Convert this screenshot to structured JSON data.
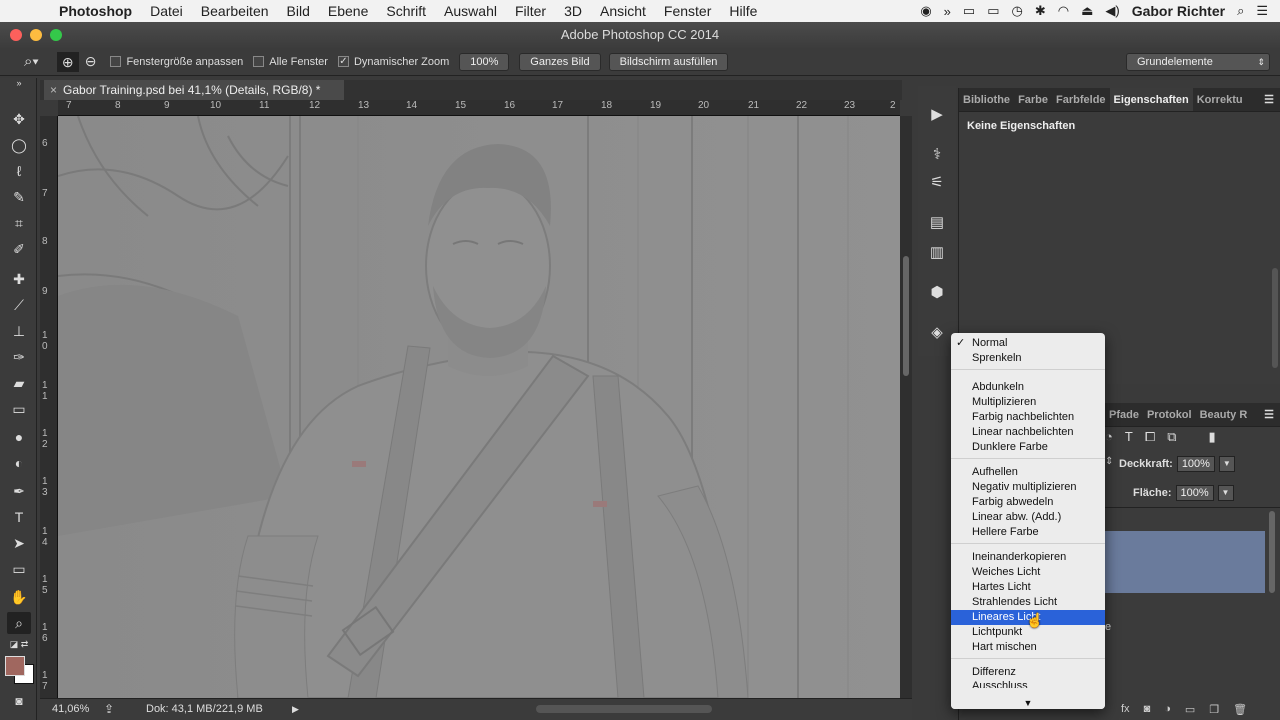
{
  "menubar": {
    "app": "Photoshop",
    "items": [
      "Datei",
      "Bearbeiten",
      "Bild",
      "Ebene",
      "Schrift",
      "Auswahl",
      "Filter",
      "3D",
      "Ansicht",
      "Fenster",
      "Hilfe"
    ],
    "user": "Gabor Richter"
  },
  "window": {
    "title": "Adobe Photoshop CC 2014"
  },
  "options": {
    "fit_window": "Fenstergröße anpassen",
    "all_windows": "Alle Fenster",
    "dynamic_zoom": "Dynamischer Zoom",
    "zoom_100": "100%",
    "fit_screen": "Ganzes Bild",
    "fill_screen": "Bildschirm ausfüllen",
    "workspace": "Grundelemente"
  },
  "document": {
    "tab_title": "Gabor Training.psd bei 41,1% (Details, RGB/8) *",
    "ruler_h": [
      "7",
      "8",
      "9",
      "10",
      "11",
      "12",
      "13",
      "14",
      "15",
      "16",
      "17",
      "18",
      "19",
      "20",
      "21",
      "22",
      "23",
      "2"
    ],
    "ruler_v": [
      "6",
      "7",
      "8",
      "9",
      "1 0",
      "1 1",
      "1 2",
      "1 3",
      "1 4",
      "1 5",
      "1 6",
      "1 7"
    ]
  },
  "status": {
    "zoom": "41,06%",
    "doc_size": "Dok: 43,1 MB/221,9 MB"
  },
  "properties_panel": {
    "tabs": [
      "Bibliothe",
      "Farbe",
      "Farbfelde",
      "Eigenschaften",
      "Korrektu"
    ],
    "active_tab": "Eigenschaften",
    "empty_text": "Keine Eigenschaften"
  },
  "layers_panel": {
    "tabs": [
      "Pfade",
      "Protokol",
      "Beauty R"
    ],
    "opacity_label": "Deckkraft:",
    "opacity_value": "100%",
    "fill_label": "Fläche:",
    "fill_value": "100%",
    "partial_text": "e"
  },
  "blend_menu": {
    "checked": "Normal",
    "selected": "Lineares Licht",
    "groups": [
      [
        "Normal",
        "Sprenkeln"
      ],
      [
        "Abdunkeln",
        "Multiplizieren",
        "Farbig nachbelichten",
        "Linear nachbelichten",
        "Dunklere Farbe"
      ],
      [
        "Aufhellen",
        "Negativ multiplizieren",
        "Farbig abwedeln",
        "Linear abw. (Add.)",
        "Hellere Farbe"
      ],
      [
        "Ineinanderkopieren",
        "Weiches Licht",
        "Hartes Licht",
        "Strahlendes Licht",
        "Lineares Licht",
        "Lichtpunkt",
        "Hart mischen"
      ],
      [
        "Differenz",
        "Ausschluss"
      ]
    ]
  },
  "colors": {
    "foreground": "#a0675f",
    "background": "#ffffff",
    "accent": "#2a62d9"
  }
}
